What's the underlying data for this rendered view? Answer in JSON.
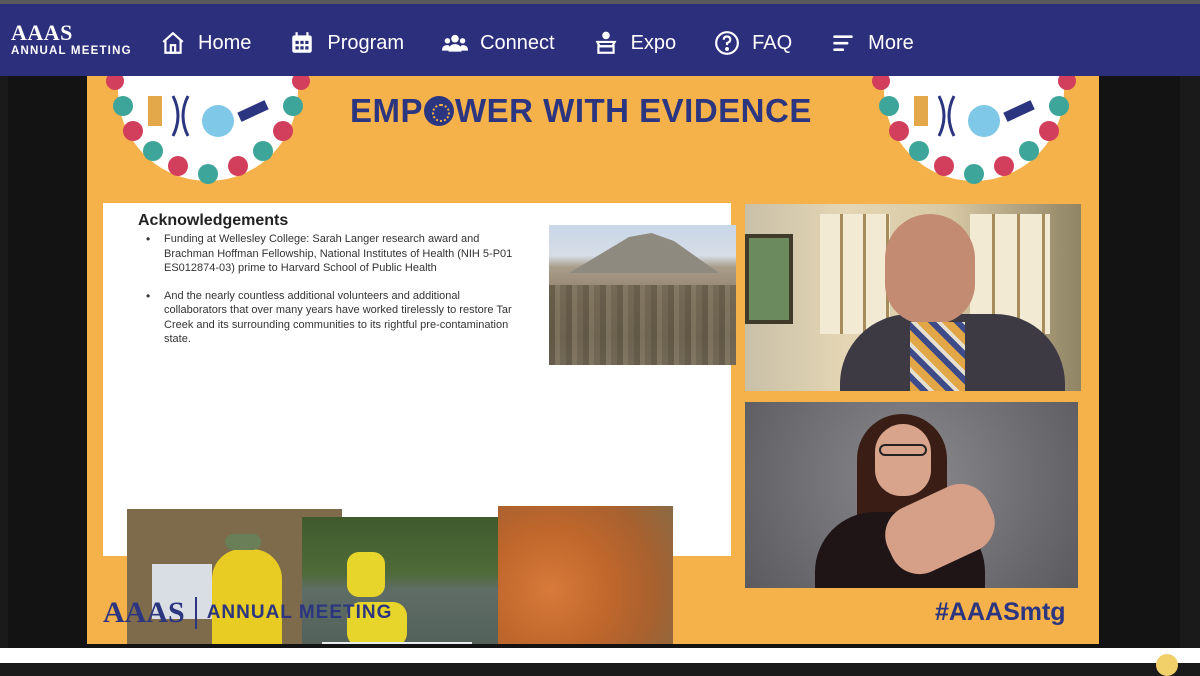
{
  "header": {
    "logo_mark": "AAAS",
    "logo_sub": "ANNUAL MEETING",
    "nav": [
      {
        "label": "Home",
        "icon": "home-icon"
      },
      {
        "label": "Program",
        "icon": "calendar-icon"
      },
      {
        "label": "Connect",
        "icon": "people-icon"
      },
      {
        "label": "Expo",
        "icon": "booth-icon"
      },
      {
        "label": "FAQ",
        "icon": "question-icon"
      },
      {
        "label": "More",
        "icon": "menu-icon"
      }
    ]
  },
  "slide": {
    "title_part1": "EMP",
    "title_part2": "WER WITH EVIDENCE",
    "ack_title": "Acknowledgements",
    "ack_items": [
      "Funding at Wellesley College: Sarah Langer research award and Brachman Hoffman Fellowship, National Institutes of Health (NIH 5-P01 ES012874-03) prime to Harvard School of Public Health",
      "And the nearly countless additional volunteers and additional collaborators that over many years have worked tirelessly to restore Tar Creek and its surrounding communities to its rightful pre-contamination state."
    ],
    "footer_logo_mark": "AAAS",
    "footer_logo_text": "ANNUAL MEETING",
    "hashtag": "#AAASmtg"
  },
  "colors": {
    "nav_bg": "#2c2f7c",
    "slide_bg": "#f5b14a",
    "brand_blue": "#2c3580"
  }
}
